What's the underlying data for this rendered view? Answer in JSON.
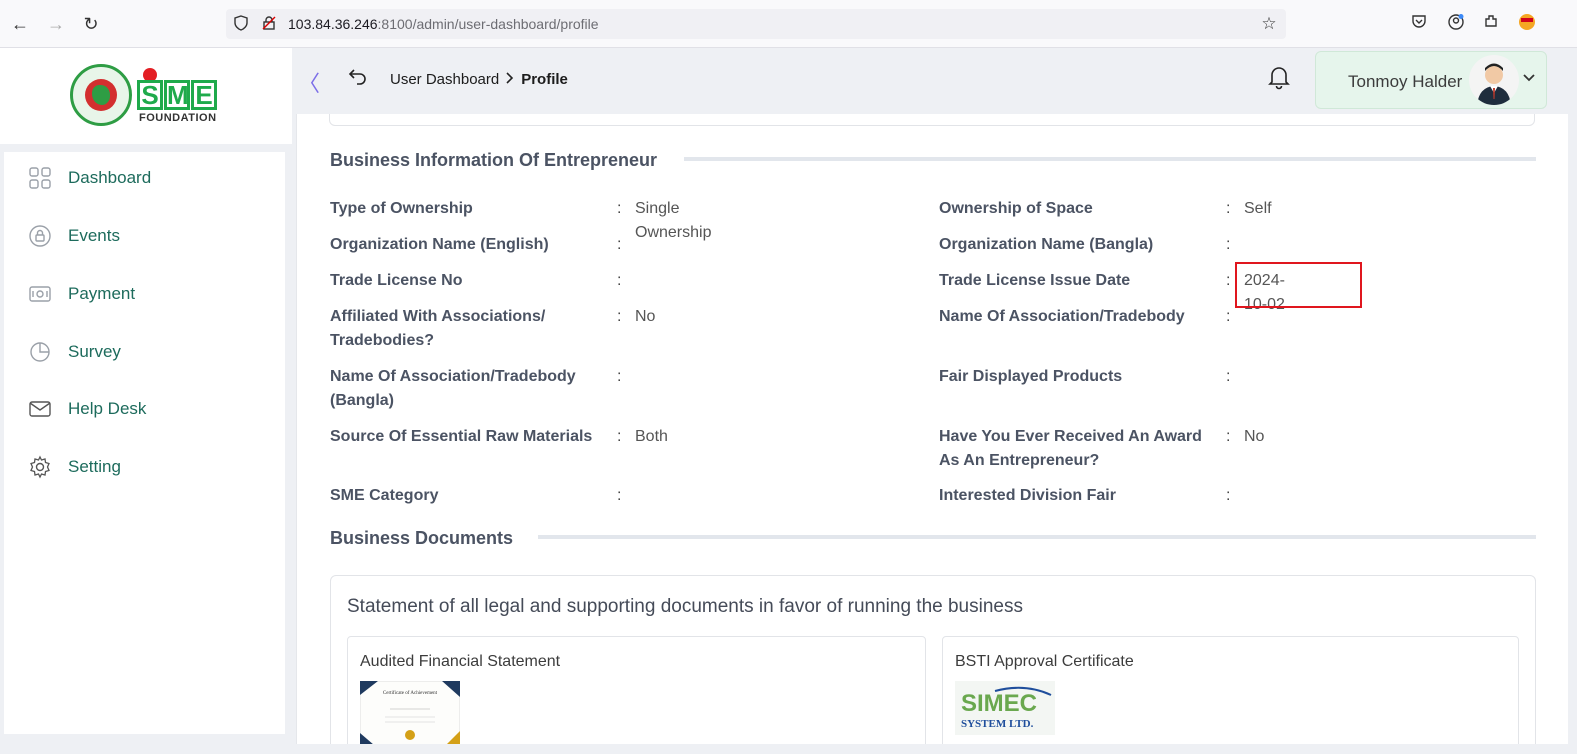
{
  "browser": {
    "url_host": "103.84.36.246",
    "url_rest": ":8100/admin/user-dashboard/profile"
  },
  "logo": {
    "sme_letters": [
      "S",
      "M",
      "E"
    ],
    "foundation_text": "FOUNDATION"
  },
  "sidebar": {
    "items": [
      {
        "label": "Dashboard",
        "icon": "grid-icon"
      },
      {
        "label": "Events",
        "icon": "lock-circle-icon"
      },
      {
        "label": "Payment",
        "icon": "cash-icon"
      },
      {
        "label": "Survey",
        "icon": "pie-chart-icon"
      },
      {
        "label": "Help Desk",
        "icon": "envelope-icon"
      },
      {
        "label": "Setting",
        "icon": "gear-icon"
      }
    ]
  },
  "header": {
    "breadcrumb": [
      "User Dashboard",
      "Profile"
    ],
    "user_name": "Tonmoy Halder"
  },
  "business_info": {
    "title": "Business Information Of Entrepreneur",
    "rows": [
      {
        "left_label": [
          "Type of Ownership"
        ],
        "left_value": "Single Ownership",
        "right_label": [
          "Ownership of Space"
        ],
        "right_value": "Self"
      },
      {
        "left_label": [
          "Organization Name (English)"
        ],
        "left_value": "",
        "right_label": [
          "Organization Name (Bangla)"
        ],
        "right_value": ""
      },
      {
        "left_label": [
          "Trade License No"
        ],
        "left_value": "",
        "right_label": [
          "Trade License Issue Date"
        ],
        "right_value": "2024-10-02"
      },
      {
        "left_label": [
          "Affiliated With Associations/",
          "Tradebodies?"
        ],
        "left_value": "No",
        "right_label": [
          "Name Of Association/Tradebody"
        ],
        "right_value": ""
      },
      {
        "left_label": [
          "Name Of Association/Tradebody",
          "(Bangla)"
        ],
        "left_value": "",
        "right_label": [
          "Fair Displayed Products"
        ],
        "right_value": ""
      },
      {
        "left_label": [
          "Source Of Essential Raw Materials"
        ],
        "left_value": "Both",
        "right_label": [
          "Have You Ever Received An Award",
          "As An Entrepreneur?"
        ],
        "right_value": "No"
      },
      {
        "left_label": [
          "SME Category"
        ],
        "left_value": "",
        "right_label": [
          "Interested Division Fair"
        ],
        "right_value": ""
      }
    ]
  },
  "business_documents": {
    "title": "Business Documents",
    "statement": "Statement of all legal and supporting documents in favor of running the business",
    "documents": [
      {
        "title": "Audited Financial Statement",
        "thumb_text": "Certificate of Achievement"
      },
      {
        "title": "BSTI Approval Certificate",
        "thumb_text": "SIMEC",
        "thumb_subtext": "SYSTEM LTD."
      }
    ]
  },
  "colors": {
    "sidebar_text": "#1d6b5c",
    "label_text": "#4b5363",
    "highlight": "#e0161e",
    "user_box": "#e6f5ec"
  }
}
